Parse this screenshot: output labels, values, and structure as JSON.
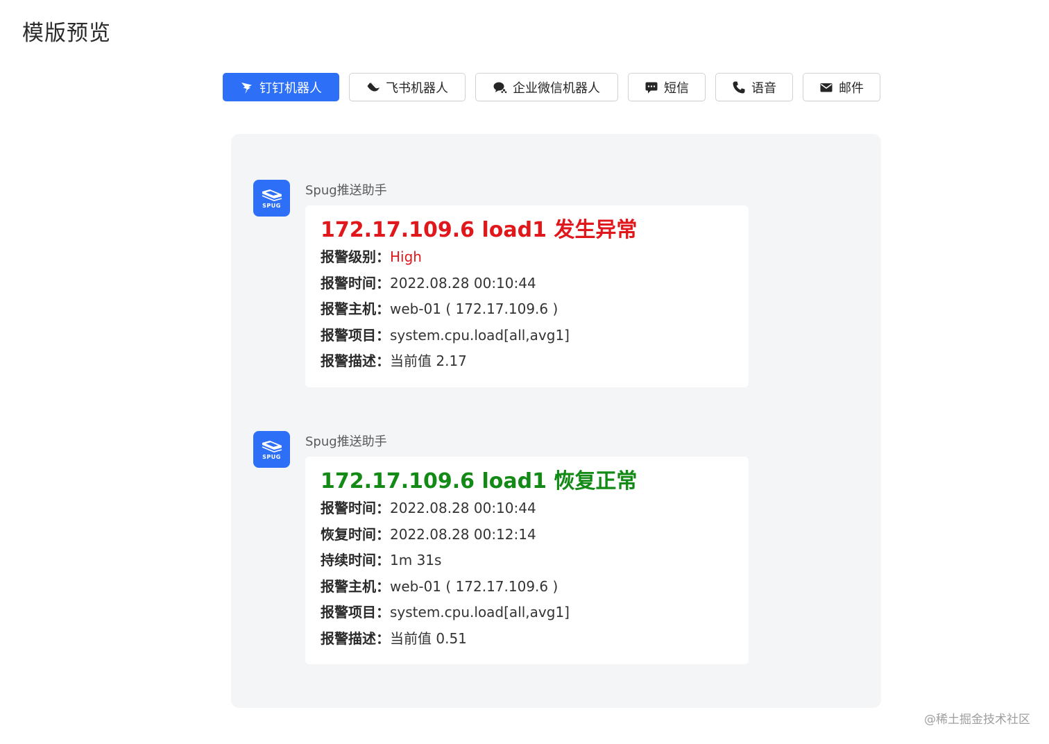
{
  "page": {
    "title": "模版预览"
  },
  "tabs": [
    {
      "label": "钉钉机器人",
      "icon": "dingtalk-icon",
      "active": true
    },
    {
      "label": "飞书机器人",
      "icon": "feishu-icon",
      "active": false
    },
    {
      "label": "企业微信机器人",
      "icon": "wechat-icon",
      "active": false
    },
    {
      "label": "短信",
      "icon": "sms-icon",
      "active": false
    },
    {
      "label": "语音",
      "icon": "phone-icon",
      "active": false
    },
    {
      "label": "邮件",
      "icon": "mail-icon",
      "active": false
    }
  ],
  "messages": [
    {
      "sender": "Spug推送助手",
      "avatar_text": "SPUG",
      "title": "172.17.109.6 load1 发生异常",
      "title_color": "#e0181b",
      "rows": [
        {
          "key": "报警级别：",
          "value": "High"
        },
        {
          "key": "报警时间：",
          "value": "2022.08.28 00:10:44"
        },
        {
          "key": "报警主机：",
          "value": "web-01 ( 172.17.109.6 )"
        },
        {
          "key": "报警项目：",
          "value": "system.cpu.load[all,avg1]"
        },
        {
          "key": "报警描述：",
          "value": "当前值 2.17"
        }
      ]
    },
    {
      "sender": "Spug推送助手",
      "avatar_text": "SPUG",
      "title": "172.17.109.6 load1 恢复正常",
      "title_color": "#138a15",
      "rows": [
        {
          "key": "报警时间：",
          "value": "2022.08.28 00:10:44"
        },
        {
          "key": "恢复时间：",
          "value": "2022.08.28 00:12:14"
        },
        {
          "key": "持续时间：",
          "value": "1m 31s"
        },
        {
          "key": "报警主机：",
          "value": "web-01 ( 172.17.109.6 )"
        },
        {
          "key": "报警项目：",
          "value": "system.cpu.load[all,avg1]"
        },
        {
          "key": "报警描述：",
          "value": "当前值 0.51"
        }
      ]
    }
  ],
  "colors": {
    "accent": "#2d6ff6",
    "alert_high": "#e0181b"
  },
  "watermark": "@稀土掘金技术社区"
}
